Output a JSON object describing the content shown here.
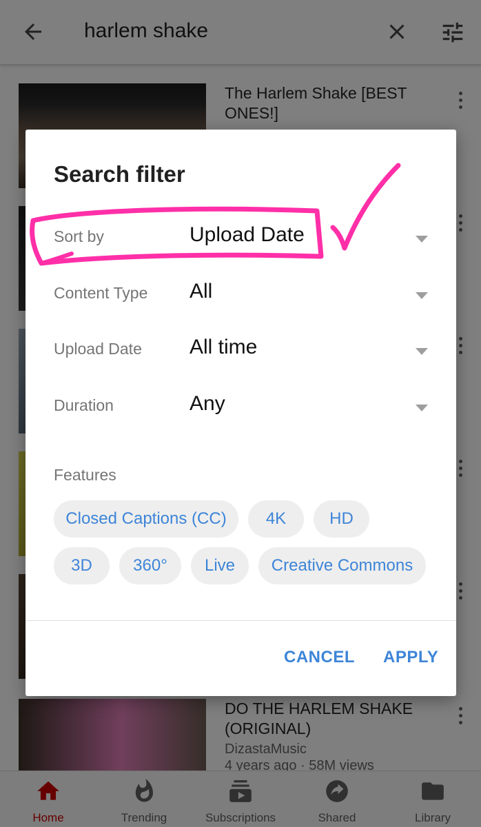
{
  "search": {
    "query": "harlem shake"
  },
  "results": [
    {
      "title": "The Harlem Shake [BEST ONES!]",
      "channel": "",
      "meta": ""
    },
    {
      "title": "DO THE HARLEM SHAKE (ORIGINAL)",
      "channel": "DizastaMusic",
      "meta": "4 years ago · 58M views"
    }
  ],
  "nav": {
    "items": [
      {
        "label": "Home",
        "icon": "home-icon"
      },
      {
        "label": "Trending",
        "icon": "flame-icon"
      },
      {
        "label": "Subscriptions",
        "icon": "subscriptions-icon"
      },
      {
        "label": "Shared",
        "icon": "share-icon"
      },
      {
        "label": "Library",
        "icon": "folder-icon"
      }
    ]
  },
  "dialog": {
    "title": "Search filter",
    "filters": [
      {
        "label": "Sort by",
        "value": "Upload Date"
      },
      {
        "label": "Content Type",
        "value": "All"
      },
      {
        "label": "Upload Date",
        "value": "All time"
      },
      {
        "label": "Duration",
        "value": "Any"
      }
    ],
    "features_label": "Features",
    "features": [
      "Closed Captions (CC)",
      "4K",
      "HD",
      "3D",
      "360°",
      "Live",
      "Creative Commons"
    ],
    "cancel_label": "CANCEL",
    "apply_label": "APPLY"
  },
  "colors": {
    "accent": "#3d85d8",
    "brand_red": "#cc0000",
    "annotation": "#ff2fa8"
  }
}
